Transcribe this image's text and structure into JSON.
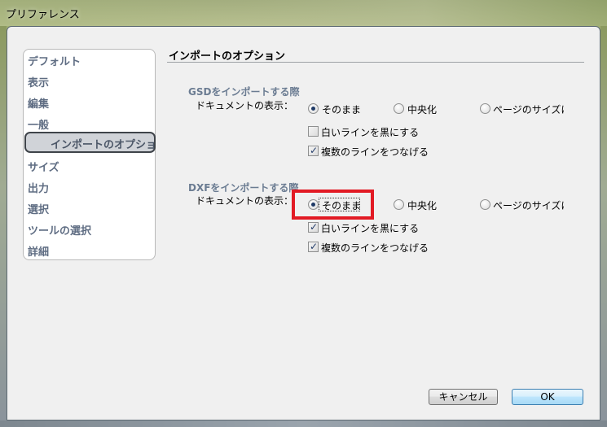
{
  "window": {
    "title": "プリファレンス"
  },
  "nav": {
    "items": [
      {
        "label": "デフォルト"
      },
      {
        "label": "表示"
      },
      {
        "label": "編集"
      },
      {
        "label": "一般"
      },
      {
        "label": "インポートのオプション"
      },
      {
        "label": "サイズ"
      },
      {
        "label": "出力"
      },
      {
        "label": "選択"
      },
      {
        "label": "ツールの選択"
      },
      {
        "label": "詳細"
      }
    ],
    "selected": "インポートのオプション"
  },
  "section": {
    "title": "インポートのオプション"
  },
  "gsd": {
    "group_label": "GSDをインポートする際",
    "display_label": "ドキュメントの表示：",
    "options": [
      {
        "label": "そのまま",
        "checked": true
      },
      {
        "label": "中央化",
        "checked": false
      },
      {
        "label": "ページのサイズに",
        "checked": false
      }
    ],
    "white_to_black": {
      "label": "白いラインを黒にする",
      "checked": false
    },
    "join_lines": {
      "label": "複数のラインをつなげる",
      "checked": true
    }
  },
  "dxf": {
    "group_label": "DXFをインポートする際",
    "display_label": "ドキュメントの表示：",
    "options": [
      {
        "label": "そのまま",
        "checked": true
      },
      {
        "label": "中央化",
        "checked": false
      },
      {
        "label": "ページのサイズに",
        "checked": false
      }
    ],
    "white_to_black": {
      "label": "白いラインを黒にする",
      "checked": true
    },
    "join_lines": {
      "label": "複数のラインをつなげる",
      "checked": true
    }
  },
  "buttons": {
    "cancel": "キャンセル",
    "ok": "OK"
  },
  "colors": {
    "highlight": "#e21a24",
    "nav_text": "#5f6d83",
    "group_label": "#6b7c92"
  }
}
